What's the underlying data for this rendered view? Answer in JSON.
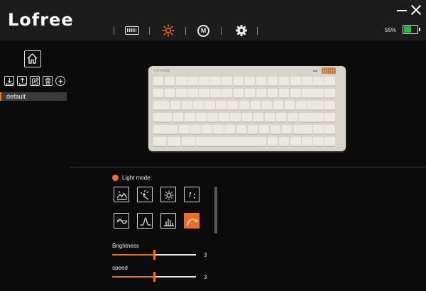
{
  "app": {
    "logo": "Lofree"
  },
  "window": {
    "minimize_icon": "minimize-icon",
    "close_icon": "close-icon"
  },
  "nav": {
    "items": [
      {
        "name": "keyboard-icon",
        "active": false
      },
      {
        "name": "light-icon",
        "active": true
      },
      {
        "name": "macro-icon",
        "label": "M",
        "active": false
      },
      {
        "name": "gear-icon",
        "active": false
      }
    ]
  },
  "battery": {
    "percent_label": "55%",
    "level": 0.55,
    "color": "#19c12e"
  },
  "sidebar": {
    "home_icon": "home-icon",
    "tools": [
      "import-icon",
      "export-icon",
      "edit-icon",
      "delete-icon",
      "add-icon"
    ],
    "profiles": [
      {
        "label": "default",
        "selected": true
      }
    ]
  },
  "keyboard": {
    "brand": "LOFREE"
  },
  "lighting": {
    "mode_label": "Light mode",
    "effects": [
      {
        "name": "effect-mountain-icon",
        "active": false
      },
      {
        "name": "effect-ripple-icon",
        "active": false
      },
      {
        "name": "effect-sun-icon",
        "active": false
      },
      {
        "name": "effect-scatter-icon",
        "active": false
      },
      {
        "name": "effect-wave-icon",
        "active": false
      },
      {
        "name": "effect-peak-icon",
        "active": false
      },
      {
        "name": "effect-bars-icon",
        "active": false
      },
      {
        "name": "effect-arc-icon",
        "active": true
      }
    ],
    "brightness": {
      "label": "Brightness",
      "value": "3",
      "level": 0.5
    },
    "speed": {
      "label": "speed",
      "value": "3",
      "level": 0.5
    }
  },
  "colors": {
    "accent": "#f36c21",
    "topbar": "#1c1c1c",
    "background": "#0b0b0b"
  }
}
